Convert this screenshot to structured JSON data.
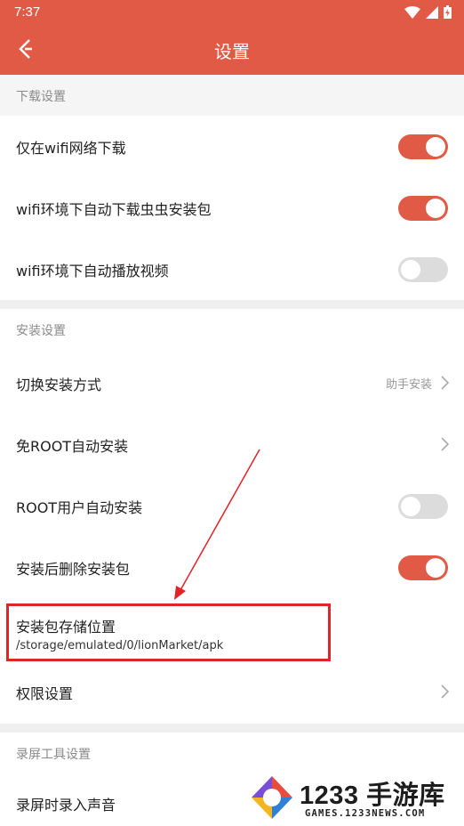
{
  "status_bar": {
    "time": "7:37"
  },
  "header": {
    "title": "设置"
  },
  "sections": {
    "download": {
      "title": "下载设置",
      "items": [
        {
          "label": "仅在wifi网络下载",
          "toggle": "on"
        },
        {
          "label": "wifi环境下自动下载虫虫安装包",
          "toggle": "on"
        },
        {
          "label": "wifi环境下自动播放视频",
          "toggle": "off"
        }
      ]
    },
    "install": {
      "title": "安装设置",
      "items": [
        {
          "label": "切换安装方式",
          "value": "助手安装"
        },
        {
          "label": "免ROOT自动安装"
        },
        {
          "label": "ROOT用户自动安装",
          "toggle": "off"
        },
        {
          "label": "安装后删除安装包",
          "toggle": "on"
        },
        {
          "label": "安装包存储位置",
          "sub": "/storage/emulated/0/lionMarket/apk"
        },
        {
          "label": "权限设置"
        }
      ]
    },
    "record": {
      "title": "录屏工具设置",
      "items": [
        {
          "label": "录屏时录入声音"
        }
      ]
    }
  },
  "watermark": {
    "brand": "1233 手游库",
    "domain": "GAMES.1233NEWS.COM"
  },
  "colors": {
    "accent": "#e05a45",
    "annotation": "#e0242a",
    "toggle_off": "#dcdcdc"
  }
}
